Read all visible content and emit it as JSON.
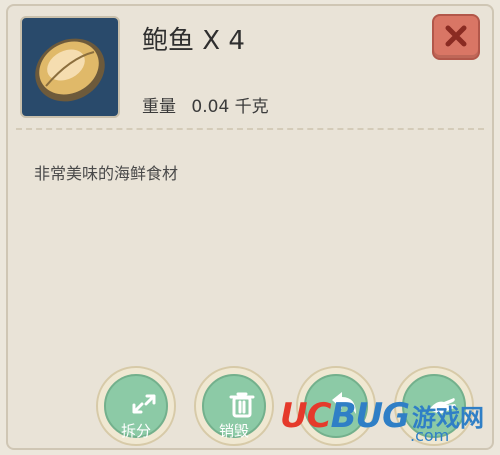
{
  "item": {
    "name": "鲍鱼 X 4",
    "weight_label": "重量",
    "weight_value": "0.04 千克",
    "description": "非常美味的海鲜食材",
    "icon": "abalone-icon"
  },
  "close": {
    "icon": "close-x-icon",
    "color": "#d97665"
  },
  "actions": [
    {
      "label": "拆分",
      "icon": "split-arrows-icon"
    },
    {
      "label": "销毁",
      "icon": "trash-icon"
    },
    {
      "label": "",
      "icon": "back-arrow-icon"
    },
    {
      "label": "",
      "icon": "hand-icon"
    }
  ],
  "accent": "#8ccaa6",
  "watermark": {
    "en": "UCBUG",
    "zh": "游戏网",
    "domain": ".com"
  }
}
